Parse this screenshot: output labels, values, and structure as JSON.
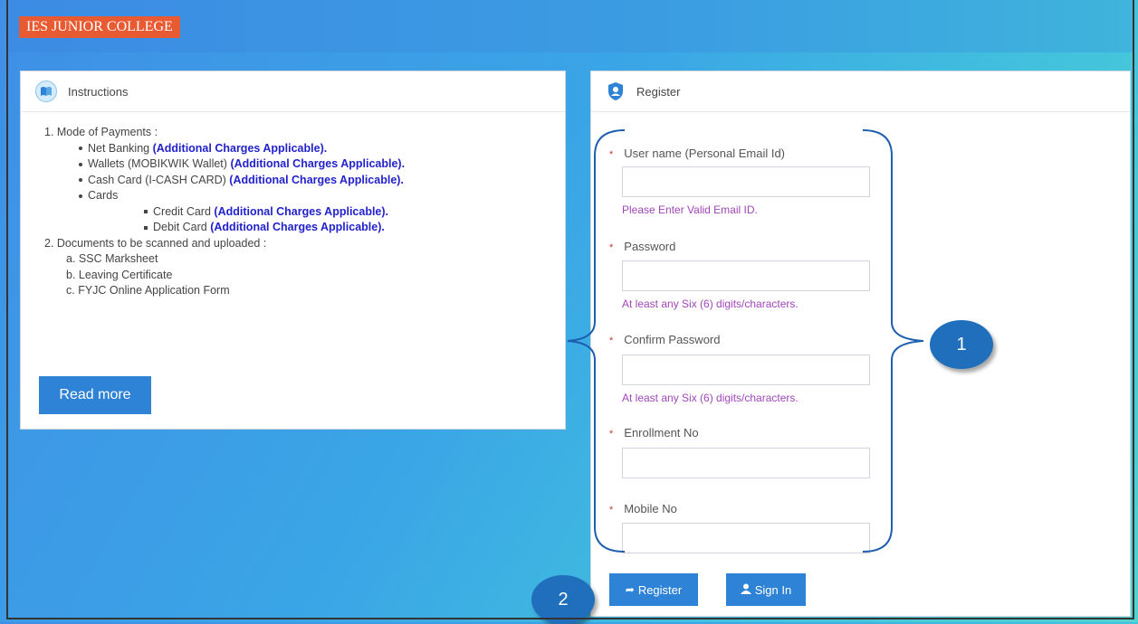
{
  "brand": "IES JUNIOR COLLEGE",
  "instructions": {
    "title": "Instructions",
    "lines": {
      "payments": "1. Mode of Payments :",
      "net_banking": "Net Banking",
      "wallets": "Wallets (MOBIKWIK Wallet)",
      "cash_card": "Cash Card (I-CASH CARD)",
      "cards": "Cards",
      "credit_card": "Credit Card",
      "debit_card": "Debit Card",
      "charges": "(Additional Charges Applicable).",
      "documents": "2. Documents to be scanned and uploaded :",
      "doc_a": "a. SSC Marksheet",
      "doc_b": "b. Leaving Certificate",
      "doc_c": "c. FYJC Online Application Form"
    },
    "read_more": "Read more"
  },
  "register": {
    "title": "Register",
    "fields": [
      {
        "label": "User name (Personal Email Id)",
        "hint": "Please Enter Valid Email ID."
      },
      {
        "label": "Password",
        "hint": "At least any Six (6) digits/characters."
      },
      {
        "label": "Confirm Password",
        "hint": "At least any Six (6) digits/characters."
      },
      {
        "label": "Enrollment No",
        "hint": ""
      },
      {
        "label": "Mobile No",
        "hint": ""
      }
    ],
    "required_mark": "*",
    "register_button": "Register",
    "signin_button": "Sign In"
  },
  "callouts": {
    "one": "1",
    "two": "2"
  },
  "colors": {
    "brand_bg": "#e85a32",
    "button": "#2f83d6",
    "hint": "#a146b9",
    "callout": "#1f6fbd",
    "charges": "#2222cc"
  }
}
